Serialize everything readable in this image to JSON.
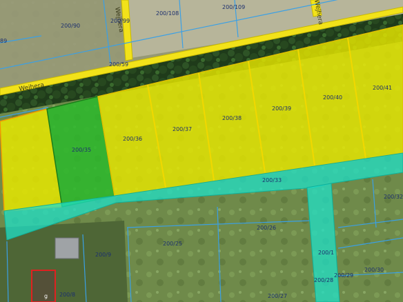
{
  "map": {
    "streets": {
      "main_road": "Wejhera",
      "side_road": "Wejhera",
      "top_right_road": "Wejhera"
    },
    "parcels": {
      "p200_108": "200/108",
      "p200_109": "200/109",
      "p200_90": "200/90",
      "p200_99": "200/99",
      "p_89": "89",
      "p200_59": "200/59",
      "p200_35": "200/35",
      "p200_36": "200/36",
      "p200_37": "200/37",
      "p200_38": "200/38",
      "p200_39": "200/39",
      "p200_40": "200/40",
      "p200_41": "200/41",
      "p200_33": "200/33",
      "p200_32": "200/32",
      "p200_26": "200/26",
      "p200_25": "200/25",
      "p200_9": "200/9",
      "p200_8": "200/8",
      "p200_1": "200/1",
      "p200_29": "200/29",
      "p200_28": "200/28",
      "p200_30": "200/30",
      "p200_27": "200/27",
      "building_marker": "g"
    },
    "colors": {
      "plot_yellow": "#e6e600",
      "plot_green": "#2bb82b",
      "road_band_cyan": "#1fe0c8",
      "road_yellow": "#f2e21a",
      "parcel_line": "#3aa0e6",
      "building_red": "#e02020"
    }
  }
}
